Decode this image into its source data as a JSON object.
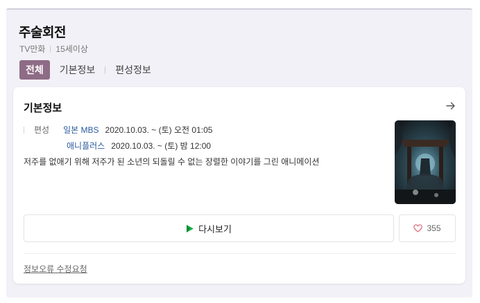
{
  "header": {
    "title": "주술회전",
    "genre": "TV만화",
    "rating": "15세이상"
  },
  "tabs": [
    {
      "label": "전체",
      "active": true
    },
    {
      "label": "기본정보",
      "active": false
    },
    {
      "label": "편성정보",
      "active": false
    }
  ],
  "basic_info": {
    "title": "기본정보",
    "schedule_label": "편성",
    "schedule": [
      {
        "channel": "일본 MBS",
        "date": "2020.10.03. ~",
        "day": "(토)",
        "time": "오전 01:05"
      },
      {
        "channel": "애니플러스",
        "date": "2020.10.03. ~",
        "day": "(토)",
        "time": "밤 12:00"
      }
    ],
    "description": "저주를 없애기 위해 저주가 된 소년의 되돌릴 수 없는 장렬한 이야기를 그린 애니메이션",
    "rewatch_label": "다시보기",
    "like_count": "355",
    "report_label": "정보오류 수정요청"
  },
  "colors": {
    "tab_active": "#8e6b86",
    "channel_link": "#2a5a9e",
    "background": "#f1f1f7"
  },
  "icons": {
    "arrow": "arrow-right-icon",
    "play": "play-icon",
    "heart": "heart-icon"
  }
}
